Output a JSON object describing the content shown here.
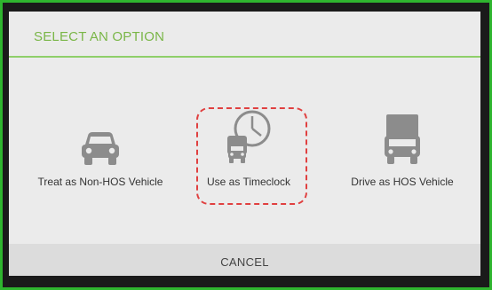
{
  "dialog": {
    "title": "SELECT AN OPTION",
    "options": [
      {
        "label": "Treat as Non-HOS Vehicle",
        "icon": "car-icon"
      },
      {
        "label": "Use as Timeclock",
        "icon": "truck-clock-icon"
      },
      {
        "label": "Drive as HOS Vehicle",
        "icon": "truck-icon"
      }
    ],
    "cancel_label": "CANCEL"
  },
  "colors": {
    "accent_green": "#7ab648",
    "frame_green": "#2fb52f",
    "highlight_red": "#e04040",
    "icon_gray": "#8c8c8c"
  }
}
